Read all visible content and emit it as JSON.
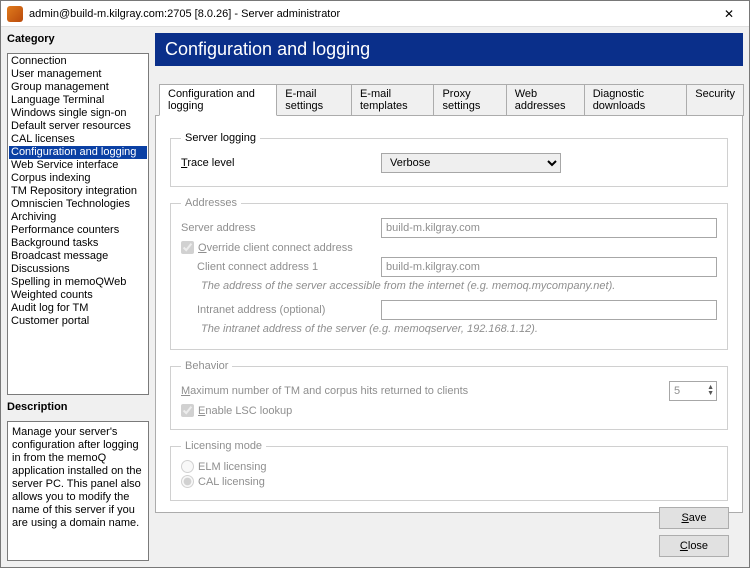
{
  "window": {
    "title": "admin@build-m.kilgray.com:2705 [8.0.26] - Server administrator",
    "close": "✕"
  },
  "sidebar": {
    "category_label": "Category",
    "description_label": "Description",
    "items": [
      "Connection",
      "User management",
      "Group management",
      "Language Terminal",
      "Windows single sign-on",
      "Default server resources",
      "CAL licenses",
      "Configuration and logging",
      "Web Service interface",
      "Corpus indexing",
      "TM Repository integration",
      "Omniscien Technologies",
      "Archiving",
      "Performance counters",
      "Background tasks",
      "Broadcast message",
      "Discussions",
      "Spelling in memoQWeb",
      "Weighted counts",
      "Audit log for TM",
      "Customer portal"
    ],
    "selected_index": 7,
    "description_text": "Manage your server's configuration after logging in from the memoQ application installed on the server PC. This panel also allows you to modify the name of this server if you are using a domain name."
  },
  "page": {
    "title": "Configuration and logging"
  },
  "tabs": {
    "items": [
      "Configuration and logging",
      "E-mail settings",
      "E-mail templates",
      "Proxy settings",
      "Web addresses",
      "Diagnostic downloads",
      "Security"
    ],
    "active_index": 0
  },
  "server_logging": {
    "legend": "Server logging",
    "trace_label": "Trace level",
    "trace_value": "Verbose"
  },
  "addresses": {
    "legend": "Addresses",
    "server_address_label": "Server address",
    "server_address_value": "build-m.kilgray.com",
    "override_label": "Override client connect address",
    "override_checked": true,
    "client_addr_label": "Client connect address 1",
    "client_addr_value": "build-m.kilgray.com",
    "client_hint": "The address of the server accessible from the internet (e.g. memoq.mycompany.net).",
    "intranet_label": "Intranet address (optional)",
    "intranet_value": "",
    "intranet_hint": "The intranet address of the server (e.g. memoqserver, 192.168.1.12)."
  },
  "behavior": {
    "legend": "Behavior",
    "max_label": "Maximum number of TM and corpus hits returned to clients",
    "max_value": "5",
    "lsc_label": "Enable LSC lookup",
    "lsc_checked": true
  },
  "licensing": {
    "legend": "Licensing mode",
    "elm_label": "ELM licensing",
    "cal_label": "CAL licensing",
    "selected": "cal"
  },
  "buttons": {
    "save": "Save",
    "close": "Close"
  }
}
